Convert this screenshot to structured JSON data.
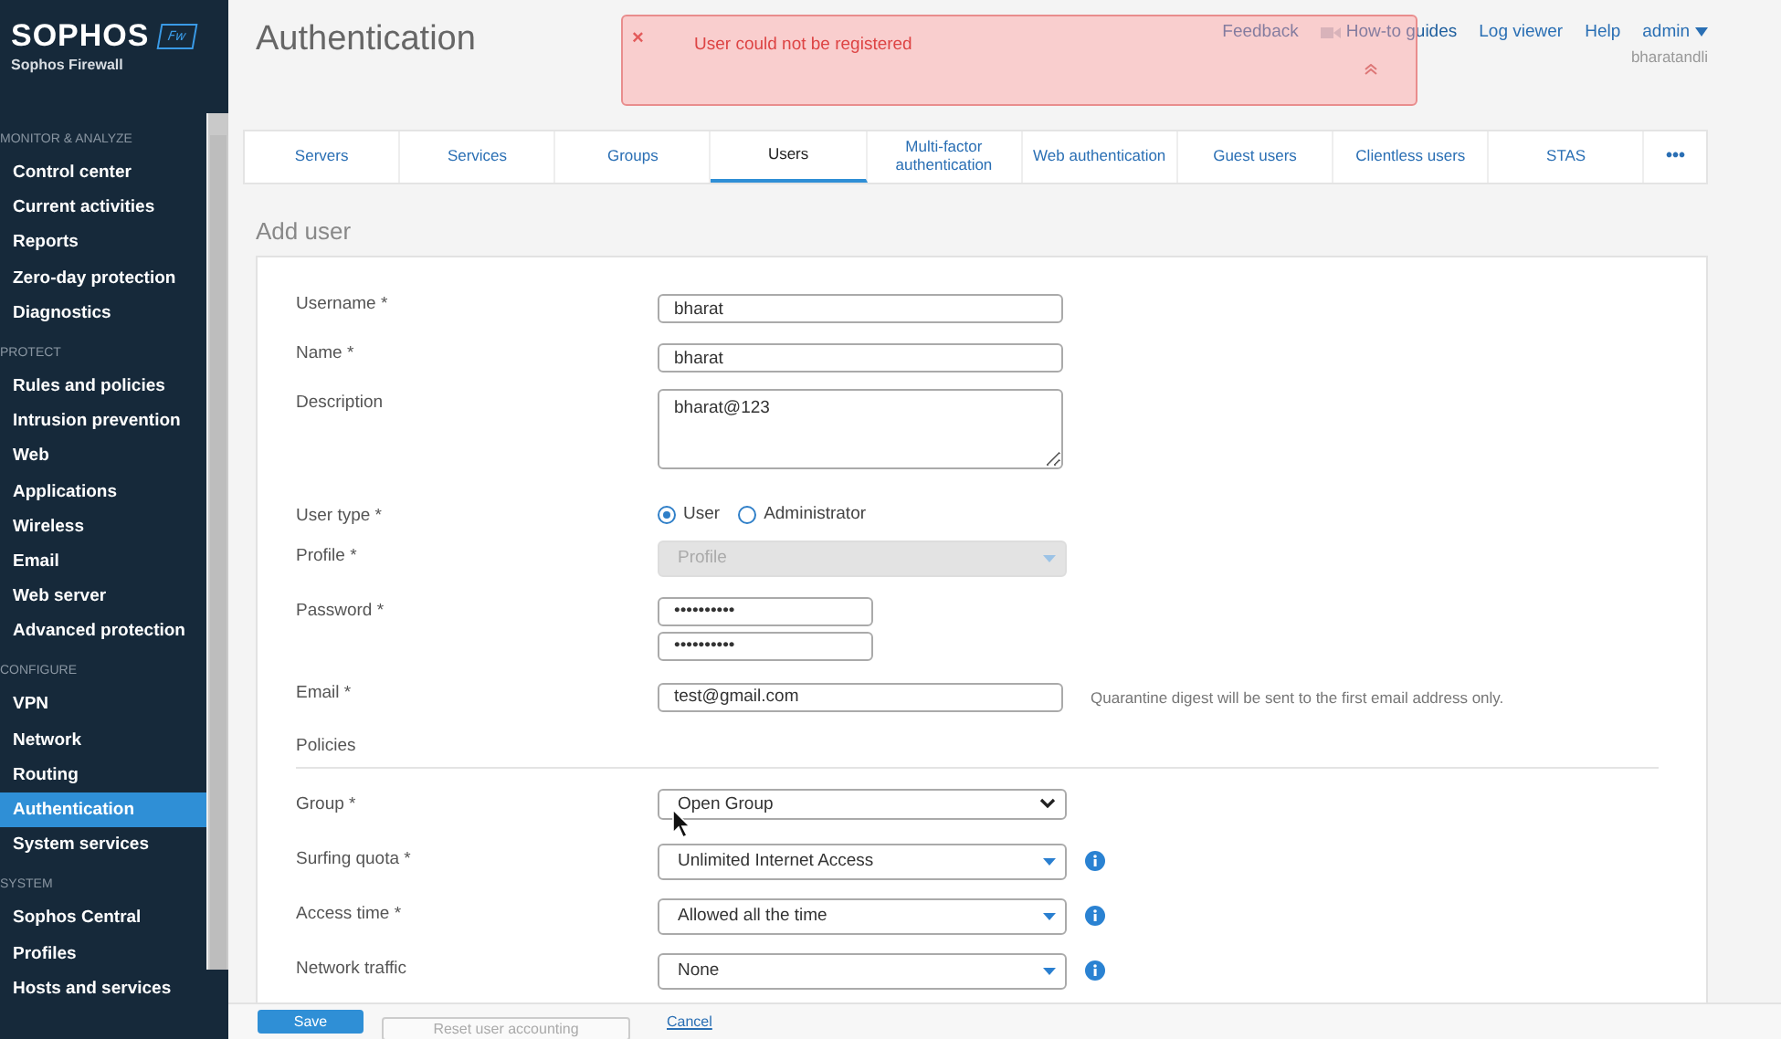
{
  "sidebar": {
    "brand": "SOPHOS",
    "badge": "Fw",
    "subtitle": "Sophos Firewall",
    "sections": [
      {
        "title": "MONITOR & ANALYZE",
        "items": [
          {
            "label": "Control center",
            "selected": false
          },
          {
            "label": "Current activities",
            "selected": false
          },
          {
            "label": "Reports",
            "selected": false
          },
          {
            "label": "Zero-day protection",
            "selected": false
          },
          {
            "label": "Diagnostics",
            "selected": false
          }
        ]
      },
      {
        "title": "PROTECT",
        "items": [
          {
            "label": "Rules and policies",
            "selected": false
          },
          {
            "label": "Intrusion prevention",
            "selected": false
          },
          {
            "label": "Web",
            "selected": false
          },
          {
            "label": "Applications",
            "selected": false
          },
          {
            "label": "Wireless",
            "selected": false
          },
          {
            "label": "Email",
            "selected": false
          },
          {
            "label": "Web server",
            "selected": false
          },
          {
            "label": "Advanced protection",
            "selected": false
          }
        ]
      },
      {
        "title": "CONFIGURE",
        "items": [
          {
            "label": "VPN",
            "selected": false
          },
          {
            "label": "Network",
            "selected": false
          },
          {
            "label": "Routing",
            "selected": false
          },
          {
            "label": "Authentication",
            "selected": true
          },
          {
            "label": "System services",
            "selected": false
          }
        ]
      },
      {
        "title": "SYSTEM",
        "items": [
          {
            "label": "Sophos Central",
            "selected": false
          },
          {
            "label": "Profiles",
            "selected": false
          },
          {
            "label": "Hosts and services",
            "selected": false
          }
        ]
      }
    ]
  },
  "header": {
    "title": "Authentication",
    "links": [
      {
        "label": "Feedback",
        "kind": "link"
      },
      {
        "label": "How-to guides",
        "kind": "video"
      },
      {
        "label": "Log viewer",
        "kind": "link"
      },
      {
        "label": "Help",
        "kind": "link"
      }
    ],
    "user": "admin",
    "host": "bharatandli"
  },
  "toast": {
    "close": "×",
    "message": "User could not be registered"
  },
  "tabs": [
    {
      "label": "Servers",
      "selected": false
    },
    {
      "label": "Services",
      "selected": false
    },
    {
      "label": "Groups",
      "selected": false
    },
    {
      "label": "Users",
      "selected": true
    },
    {
      "label": "Multi-factor authentication",
      "selected": false
    },
    {
      "label": "Web authentication",
      "selected": false
    },
    {
      "label": "Guest users",
      "selected": false
    },
    {
      "label": "Clientless users",
      "selected": false
    },
    {
      "label": "STAS",
      "selected": false
    }
  ],
  "more_tab": "•••",
  "form": {
    "title": "Add user",
    "fields": [
      {
        "kind": "text",
        "label": "Username *",
        "value": "bharat"
      },
      {
        "kind": "text",
        "label": "Name *",
        "value": "bharat"
      },
      {
        "kind": "textarea",
        "label": "Description",
        "value": "bharat@123"
      },
      {
        "kind": "radio",
        "label": "User type *",
        "options": [
          {
            "label": "User",
            "selected": true
          },
          {
            "label": "Administrator",
            "selected": false
          }
        ]
      },
      {
        "kind": "select",
        "label": "Profile *",
        "value": "Profile",
        "disabled": true
      },
      {
        "kind": "password",
        "label": "Password *",
        "values": [
          "••••••••••",
          "••••••••••"
        ]
      },
      {
        "kind": "email",
        "label": "Email *",
        "value": "test@gmail.com",
        "hint": "Quarantine digest will be sent to the first email address only."
      },
      {
        "kind": "section",
        "label": "Policies"
      },
      {
        "kind": "native_select",
        "label": "Group *",
        "value": "Open Group"
      },
      {
        "kind": "select",
        "label": "Surfing quota *",
        "value": "Unlimited Internet Access",
        "info": true
      },
      {
        "kind": "select",
        "label": "Access time *",
        "value": "Allowed all the time",
        "info": true
      },
      {
        "kind": "select",
        "label": "Network traffic",
        "value": "None",
        "info": true
      }
    ]
  },
  "buttons": [
    {
      "label": "Save",
      "kind": "primary"
    },
    {
      "label": "Reset user accounting",
      "kind": "secondary"
    },
    {
      "label": "Cancel",
      "kind": "link"
    }
  ]
}
